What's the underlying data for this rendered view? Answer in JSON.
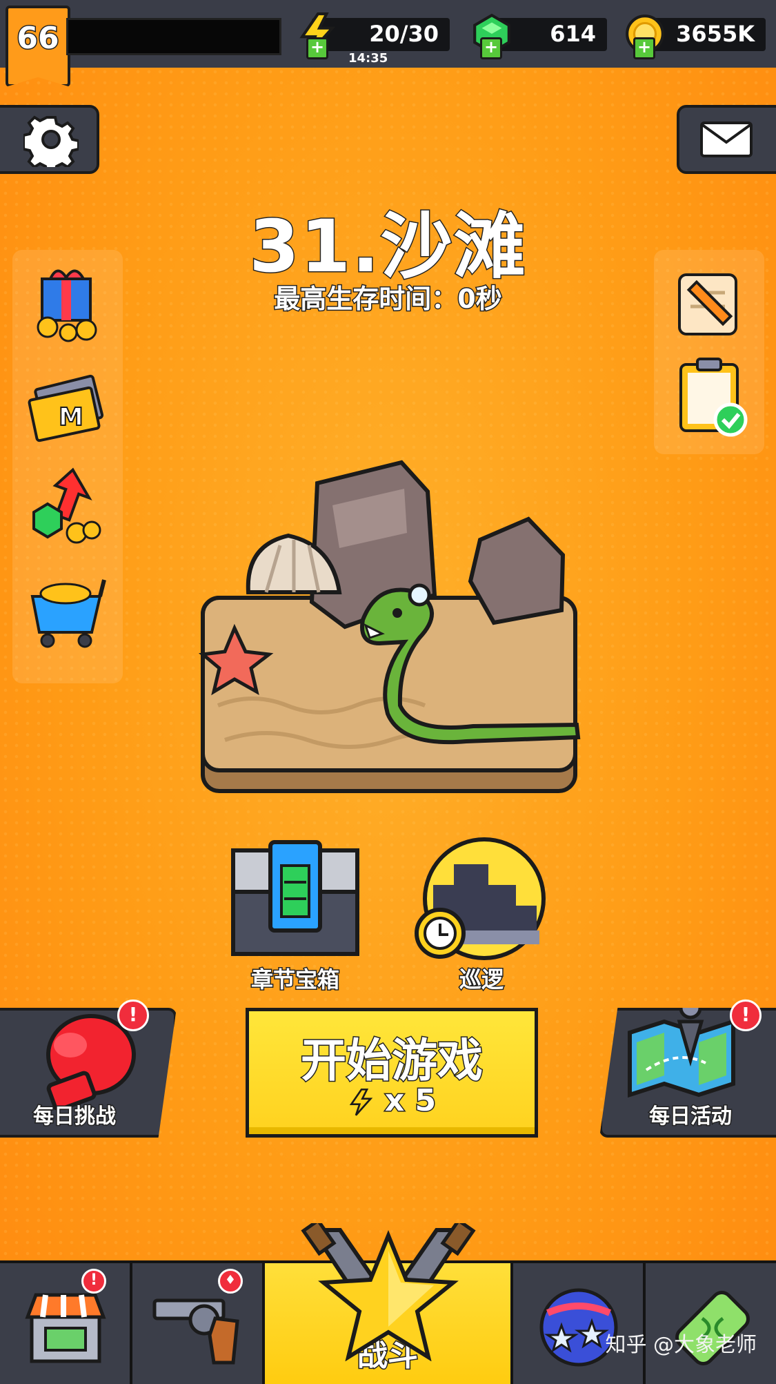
{
  "player": {
    "level": "66"
  },
  "resources": {
    "energy": "20/30",
    "energy_timer": "14:35",
    "gems": "614",
    "coins": "3655K"
  },
  "stage": {
    "title": "31.沙滩",
    "best_time": "最高生存时间：0秒"
  },
  "mid_buttons": {
    "chapter_chest": "章节宝箱",
    "patrol": "巡逻"
  },
  "main": {
    "daily_challenge": "每日挑战",
    "start_label": "开始游戏",
    "start_cost": "x 5",
    "daily_event": "每日活动"
  },
  "nav": {
    "battle": "战斗"
  },
  "badges": {
    "alert": "!"
  },
  "watermark": "知乎 @大象老师",
  "colors": {
    "background": "#ff9a14",
    "panel_dark": "#3b3e49",
    "start_button": "#ffd21f",
    "alert": "#f02d3c",
    "gem": "#2ecf5a",
    "coin": "#ffc21a"
  }
}
